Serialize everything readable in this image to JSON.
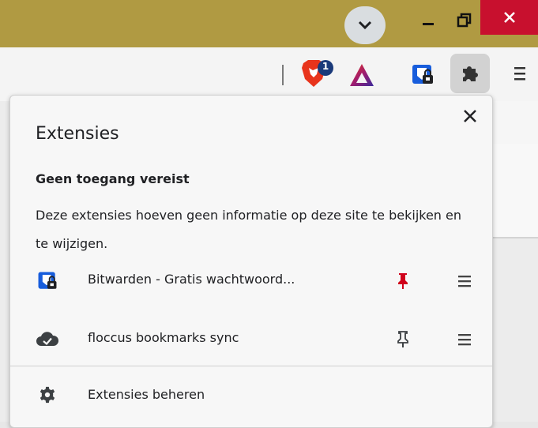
{
  "titlebar": {
    "tab_search_icon": "chevron-down-icon",
    "minimize_icon": "minimize-icon",
    "maximize_icon": "restore-icon",
    "close_icon": "close-icon",
    "close_color": "#c8102e",
    "bar_color": "#b09a42"
  },
  "toolbar": {
    "brave_badge_count": "1",
    "extensions_icon": "puzzle-icon",
    "menu_icon": "menu-icon"
  },
  "popup": {
    "title": "Extensies",
    "section_heading": "Geen toegang vereist",
    "section_description": "Deze extensies hoeven geen informatie op deze site te bekijken en te wijzigen.",
    "extensions": [
      {
        "name": "Bitwarden - Gratis wachtwoord...",
        "icon": "bitwarden-icon",
        "pinned": true,
        "pin_color": "#d0021b"
      },
      {
        "name": "floccus bookmarks sync",
        "icon": "cloud-check-icon",
        "pinned": false,
        "pin_color": "#3c4043"
      }
    ],
    "manage_label": "Extensies beheren",
    "manage_icon": "gear-icon"
  }
}
